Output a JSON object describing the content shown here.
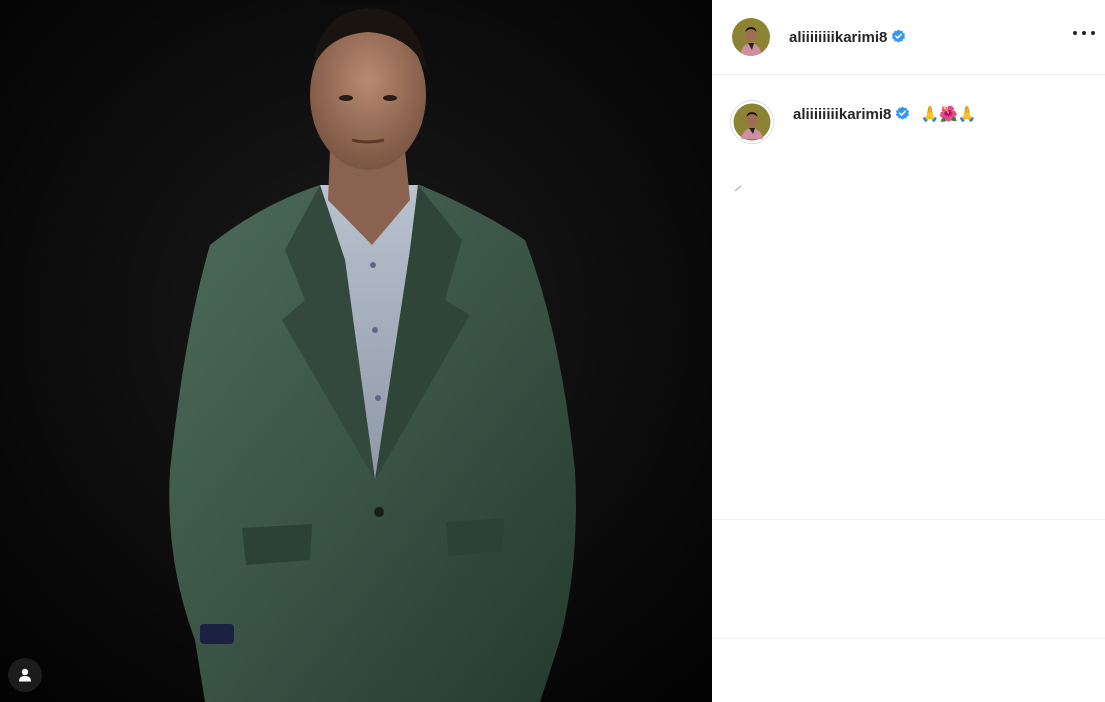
{
  "post": {
    "author": {
      "username": "aliiiiiiiikarimi8",
      "verified": true
    },
    "caption": {
      "username": "aliiiiiiiikarimi8",
      "text": "🙏🌺🙏"
    }
  },
  "icons": {
    "more": "more-options-icon",
    "verified": "verified-badge-icon",
    "tag": "user-tag-icon"
  },
  "colors": {
    "verified_blue": "#3897f0",
    "suit_green": "#3f5a4c",
    "text_dark": "#262626"
  }
}
